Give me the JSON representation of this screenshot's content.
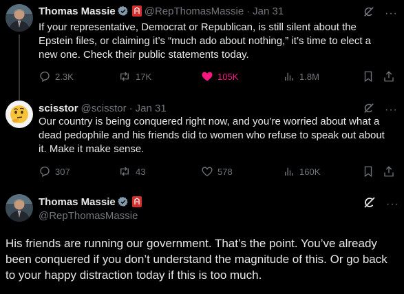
{
  "tweets": [
    {
      "author_name": "Thomas Massie",
      "handle": "@RepThomasMassie",
      "separator": "·",
      "time": "Jan 31",
      "text": "If your representative, Democrat or Republican, is still silent about the Epstein files, or claiming it’s “much ado about nothing,” it’s time to elect a new one. Check their public statements today.",
      "replies": "2.3K",
      "reposts": "17K",
      "likes": "105K",
      "views": "1.8M",
      "liked": true
    },
    {
      "author_name": "scisstor",
      "handle": "@scisstor",
      "separator": "·",
      "time": "Jan 31",
      "text": "Our country is being conquered right now, and you’re worried about what a dead pedophile and his friends did to women who refuse to speak out about it. Make it make sense.",
      "replies": "307",
      "reposts": "43",
      "likes": "578",
      "views": "160K",
      "liked": false
    }
  ],
  "main_tweet": {
    "author_name": "Thomas Massie",
    "handle": "@RepThomasMassie",
    "text": "His friends are running our government. That’s the point. You’ve already been conquered if you don’t understand the magnitude of this. Or go back to your happy distraction today if this is too much."
  },
  "more_label": "···",
  "colors": {
    "background": "#000000",
    "text": "#e7e9ea",
    "muted": "#71767b",
    "like": "#f91880",
    "verified_badge": "#829aab",
    "flag": "#d32f2f"
  },
  "icons": [
    "grok-icon",
    "more-icon",
    "reply-icon",
    "repost-icon",
    "like-icon",
    "views-icon",
    "bookmark-icon",
    "share-icon",
    "verified-badge-icon",
    "party-flag-icon"
  ]
}
